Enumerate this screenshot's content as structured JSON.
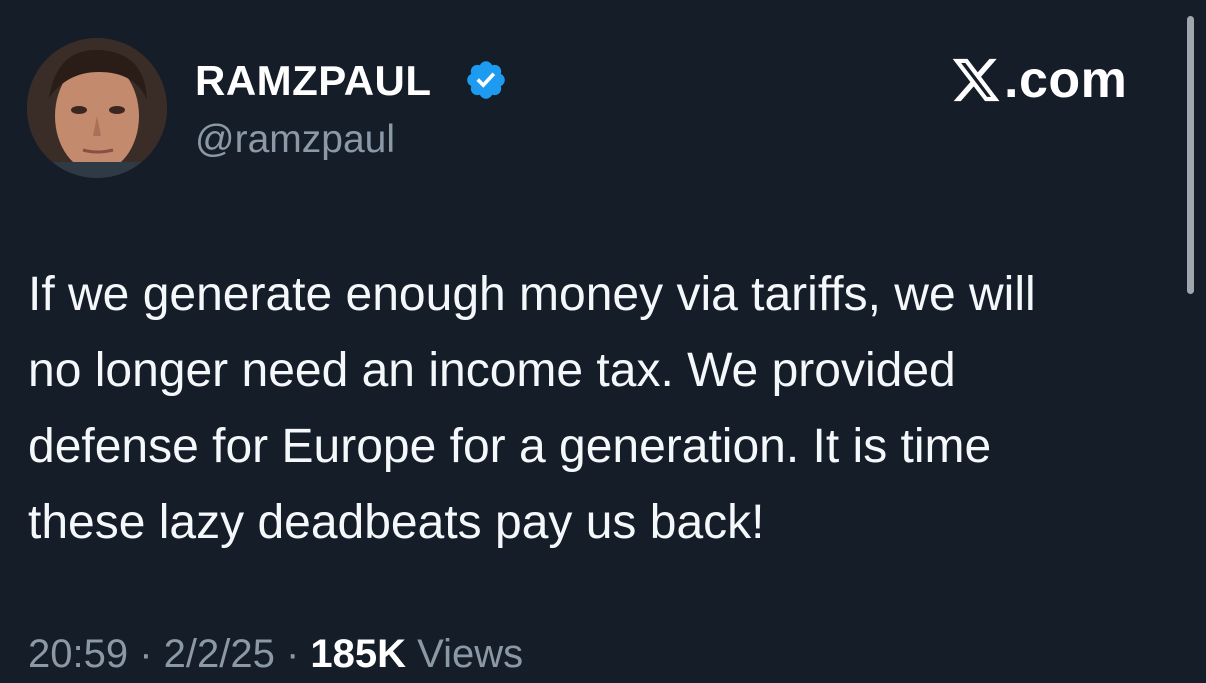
{
  "author": {
    "display_name": "RAMZPAUL",
    "handle": "@ramzpaul",
    "verified": true
  },
  "brand": {
    "icon": "x-logo-icon",
    "suffix": ".com"
  },
  "tweet": {
    "lines": [
      "If we generate enough money via tariffs, we will",
      "no longer need an income tax. We provided",
      "defense for Europe for a generation. It is time",
      "these lazy deadbeats pay us back!"
    ]
  },
  "meta": {
    "time": "20:59",
    "separator": " · ",
    "date": "2/2/25",
    "views_count": "185K",
    "views_label": "Views"
  },
  "colors": {
    "background": "#151d29",
    "secondary_text": "#8b98a5",
    "verified_blue": "#1d9bf0"
  }
}
